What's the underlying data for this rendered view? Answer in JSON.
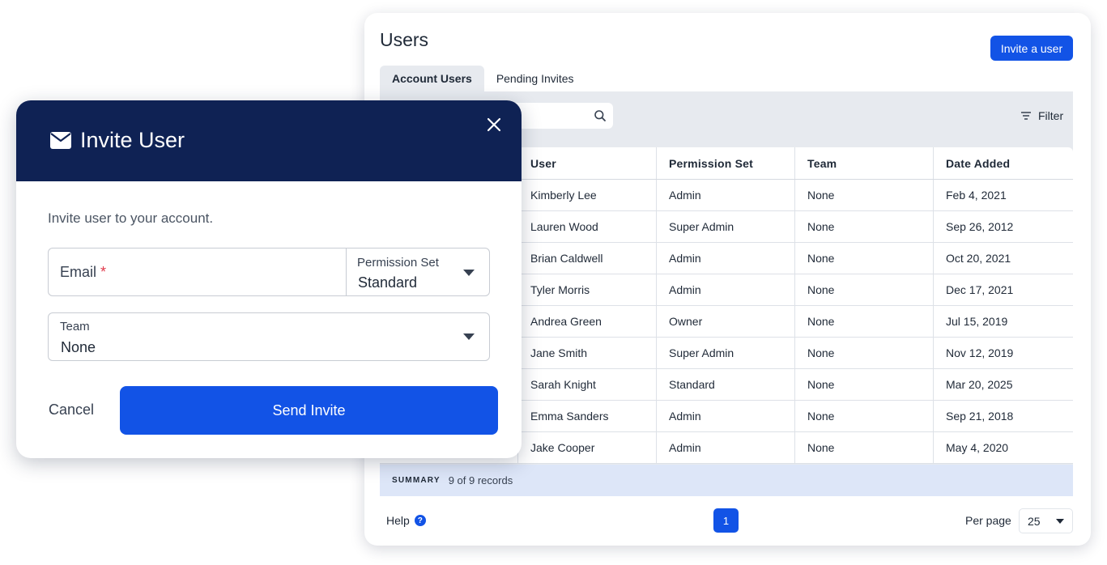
{
  "users_panel": {
    "title": "Users",
    "invite_button": "Invite a user",
    "tabs": [
      {
        "label": "Account Users",
        "active": true
      },
      {
        "label": "Pending Invites",
        "active": false
      }
    ],
    "search": {
      "placeholder": "",
      "value": ""
    },
    "filter_label": "Filter",
    "table": {
      "columns": [
        "",
        "User",
        "Permission Set",
        "Team",
        "Date Added"
      ],
      "rows": [
        [
          "Kimberly Lee",
          "Admin",
          "None",
          "Feb 4, 2021"
        ],
        [
          "Lauren Wood",
          "Super Admin",
          "None",
          "Sep 26, 2012"
        ],
        [
          "Brian Caldwell",
          "Admin",
          "None",
          "Oct 20, 2021"
        ],
        [
          "Tyler Morris",
          "Admin",
          "None",
          "Dec 17, 2021"
        ],
        [
          "Andrea Green",
          "Owner",
          "None",
          "Jul 15, 2019"
        ],
        [
          "Jane Smith",
          "Super Admin",
          "None",
          "Nov 12, 2019"
        ],
        [
          "Sarah Knight",
          "Standard",
          "None",
          "Mar 20, 2025"
        ],
        [
          "Emma Sanders",
          "Admin",
          "None",
          "Sep 21, 2018"
        ],
        [
          "Jake Cooper",
          "Admin",
          "None",
          "May 4, 2020"
        ]
      ]
    },
    "summary_label": "SUMMARY",
    "summary_value": "9 of 9 records",
    "help_label": "Help",
    "help_icon": "?",
    "current_page": "1",
    "per_page_label": "Per page",
    "per_page_value": "25"
  },
  "invite_modal": {
    "title": "Invite User",
    "description": "Invite user to your account.",
    "email_label": "Email",
    "required_marker": "*",
    "permission_label": "Permission Set",
    "permission_value": "Standard",
    "team_label": "Team",
    "team_value": "None",
    "cancel_label": "Cancel",
    "send_label": "Send Invite"
  },
  "colors": {
    "primary": "#1253e6",
    "modal_header": "#0f2254",
    "summary_bg": "#dde6f8",
    "panel_gray": "#e7eaef"
  },
  "icons": [
    "search-icon",
    "filter-icon",
    "help-icon",
    "mail-icon",
    "close-icon",
    "chevron-down-icon"
  ]
}
